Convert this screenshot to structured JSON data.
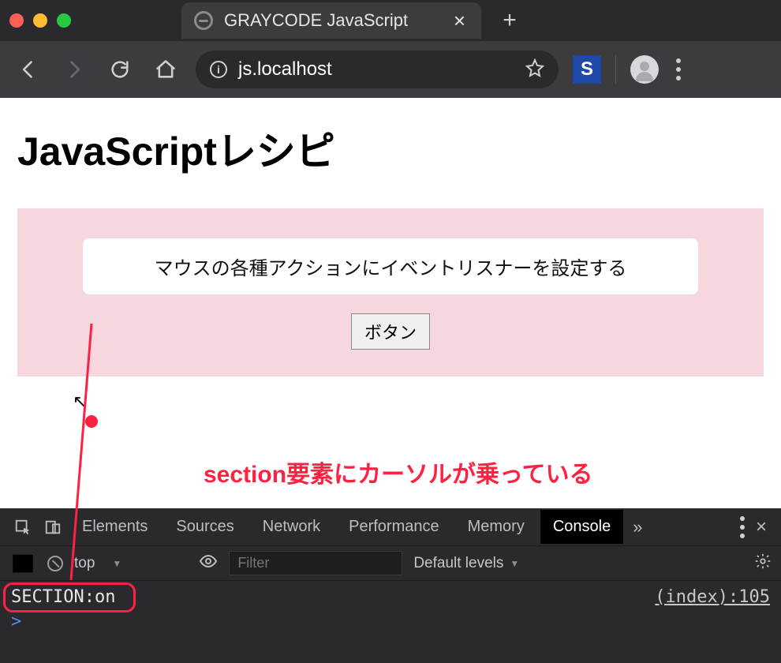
{
  "browser": {
    "tab_title": "GRAYCODE JavaScript",
    "url": "js.localhost",
    "extension_badge": "S"
  },
  "page": {
    "heading": "JavaScriptレシピ",
    "card_text": "マウスの各種アクションにイベントリスナーを設定する",
    "button_label": "ボタン"
  },
  "annotation": {
    "label": "section要素にカーソルが乗っている"
  },
  "devtools": {
    "tabs": {
      "elements": "Elements",
      "sources": "Sources",
      "network": "Network",
      "performance": "Performance",
      "memory": "Memory",
      "console": "Console"
    },
    "more": "»",
    "filter": {
      "context": "top",
      "placeholder": "Filter",
      "levels": "Default levels"
    },
    "console": {
      "message": "SECTION:on",
      "source": "(index):105",
      "prompt": ">"
    }
  }
}
